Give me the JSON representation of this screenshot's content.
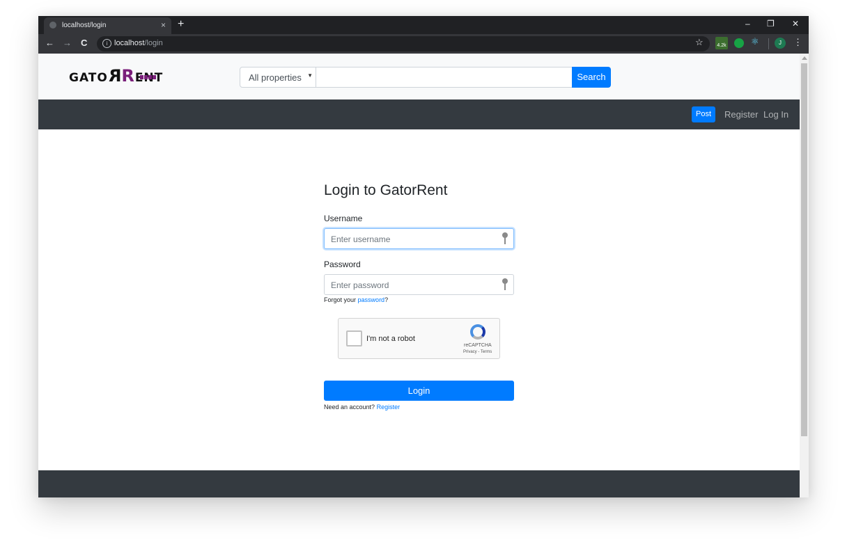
{
  "browser": {
    "tab_title": "localhost/login",
    "tab_close": "×",
    "new_tab": "+",
    "window_controls": [
      "–",
      "❐",
      "✕"
    ],
    "nav": {
      "back": "←",
      "forward": "→",
      "reload": "C"
    },
    "url_host": "localhost",
    "url_path": "/login",
    "star": "☆",
    "ext_badge": "4.2k",
    "avatar_initial": "J",
    "menu": "⋮"
  },
  "site": {
    "logo": {
      "part1": "GATO",
      "r1": "R",
      "r2": "R",
      "part2": "ENT"
    },
    "search": {
      "select_value": "All properties",
      "caret": "▼",
      "input_value": "",
      "button_label": "Search"
    },
    "nav": {
      "post_label": "Post",
      "register_label": "Register",
      "login_label": "Log In"
    }
  },
  "login": {
    "title": "Login to GatorRent",
    "username_label": "Username",
    "username_placeholder": "Enter username",
    "password_label": "Password",
    "password_placeholder": "Enter password",
    "forgot_prefix": "Forgot your",
    "forgot_link": "password",
    "forgot_suffix": "?",
    "captcha_text": "I'm not a robot",
    "captcha_brand": "reCAPTCHA",
    "captcha_terms": "Privacy - Terms",
    "login_button": "Login",
    "account_prefix": "Need an account?",
    "register_link": "Register"
  },
  "colors": {
    "accent": "#007bff",
    "navbar_dark": "#343a40",
    "logo_purple": "#7a1f7a"
  }
}
